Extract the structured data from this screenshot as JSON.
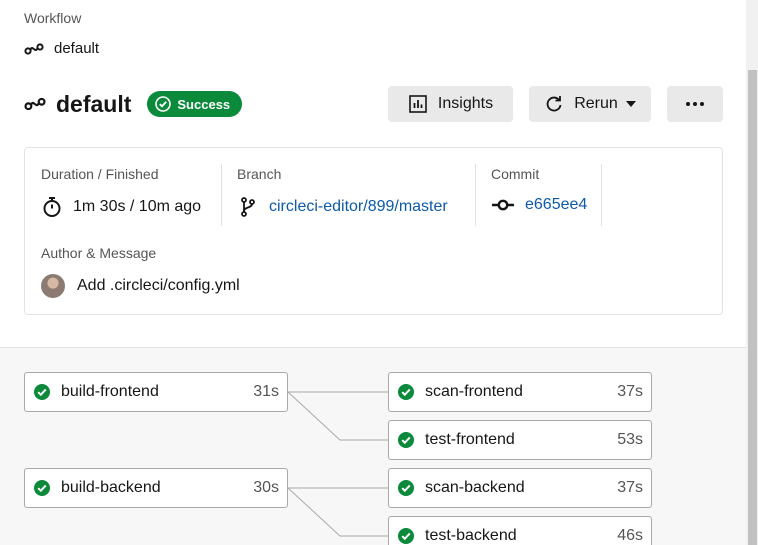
{
  "breadcrumb": {
    "label": "Workflow",
    "name": "default"
  },
  "header": {
    "title": "default",
    "status": "Success",
    "insights_label": "Insights",
    "rerun_label": "Rerun"
  },
  "details": {
    "duration_label": "Duration / Finished",
    "duration_value": "1m 30s / 10m ago",
    "branch_label": "Branch",
    "branch_value": "circleci-editor/899/master",
    "commit_label": "Commit",
    "commit_value": "e665ee4",
    "author_label": "Author & Message",
    "message": "Add .circleci/config.yml"
  },
  "jobs": [
    {
      "name": "build-frontend",
      "duration": "31s"
    },
    {
      "name": "scan-frontend",
      "duration": "37s"
    },
    {
      "name": "test-frontend",
      "duration": "53s"
    },
    {
      "name": "build-backend",
      "duration": "30s"
    },
    {
      "name": "scan-backend",
      "duration": "37s"
    },
    {
      "name": "test-backend",
      "duration": "46s"
    }
  ],
  "colors": {
    "success": "#0a8a3a",
    "link": "#0d5aa7"
  },
  "icons": {
    "workflow": "workflow-icon",
    "success": "check-circle-icon",
    "insights": "bar-chart-icon",
    "rerun": "refresh-icon",
    "more": "ellipsis-icon",
    "duration": "stopwatch-icon",
    "branch": "git-branch-icon",
    "commit": "git-commit-icon"
  }
}
